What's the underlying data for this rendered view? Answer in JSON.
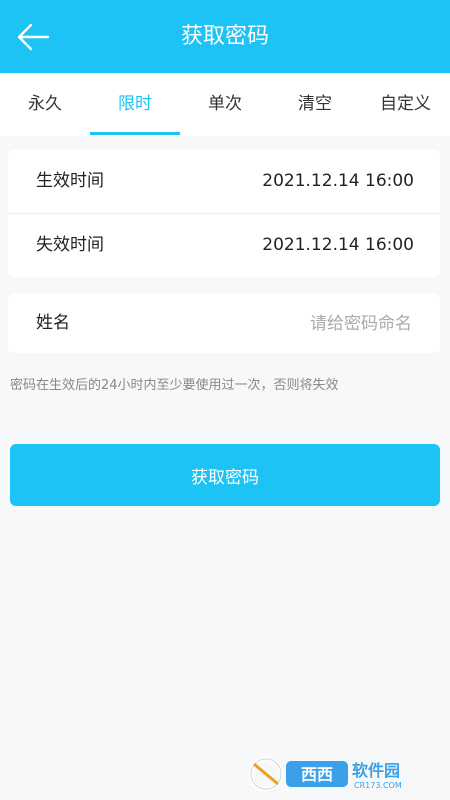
{
  "header": {
    "title": "获取密码",
    "back_icon": "arrow-left-icon"
  },
  "tabs": [
    {
      "label": "永久",
      "active": false
    },
    {
      "label": "限时",
      "active": true
    },
    {
      "label": "单次",
      "active": false
    },
    {
      "label": "清空",
      "active": false
    },
    {
      "label": "自定义",
      "active": false
    }
  ],
  "time_card": {
    "start": {
      "label": "生效时间",
      "value": "2021.12.14 16:00"
    },
    "end": {
      "label": "失效时间",
      "value": "2021.12.14 16:00"
    }
  },
  "name_field": {
    "label": "姓名",
    "value": "",
    "placeholder": "请给密码命名"
  },
  "hint": "密码在生效后的24小时内至少要使用过一次，否则将失效",
  "submit_label": "获取密码",
  "watermark": {
    "text": "西西软件园",
    "subtext": "CR173.COM"
  },
  "colors": {
    "accent": "#1ec3f5",
    "background": "#f7f8fa"
  }
}
